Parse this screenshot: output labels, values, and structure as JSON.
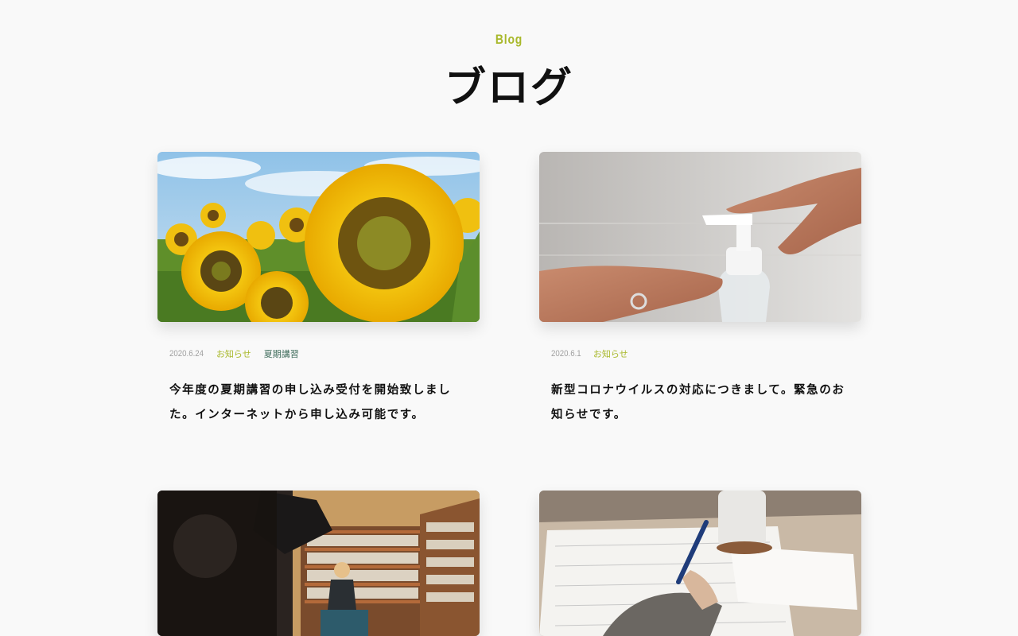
{
  "section": {
    "eyebrow": "Blog",
    "title": "ブログ"
  },
  "posts": [
    {
      "image": "sunflower-field-photo",
      "date": "2020.6.24",
      "tags": [
        "お知らせ",
        "夏期講習"
      ],
      "excerpt": "今年度の夏期講習の申し込み受付を開始致しました。インターネットから申し込み可能です。"
    },
    {
      "image": "hand-sanitizer-pump-photo",
      "date": "2020.6.1",
      "tags": [
        "お知らせ"
      ],
      "excerpt": "新型コロナウイルスの対応につきまして。緊急のお知らせです。"
    },
    {
      "image": "library-interview-photo",
      "date": "",
      "tags": [],
      "excerpt": ""
    },
    {
      "image": "writing-with-pen-photo",
      "date": "",
      "tags": [],
      "excerpt": ""
    }
  ],
  "colors": {
    "background": "#f9f9f9",
    "accent": "#a8b82a",
    "tag_secondary": "#3d6b5a",
    "text": "#111111",
    "date": "#a0a0a0"
  }
}
